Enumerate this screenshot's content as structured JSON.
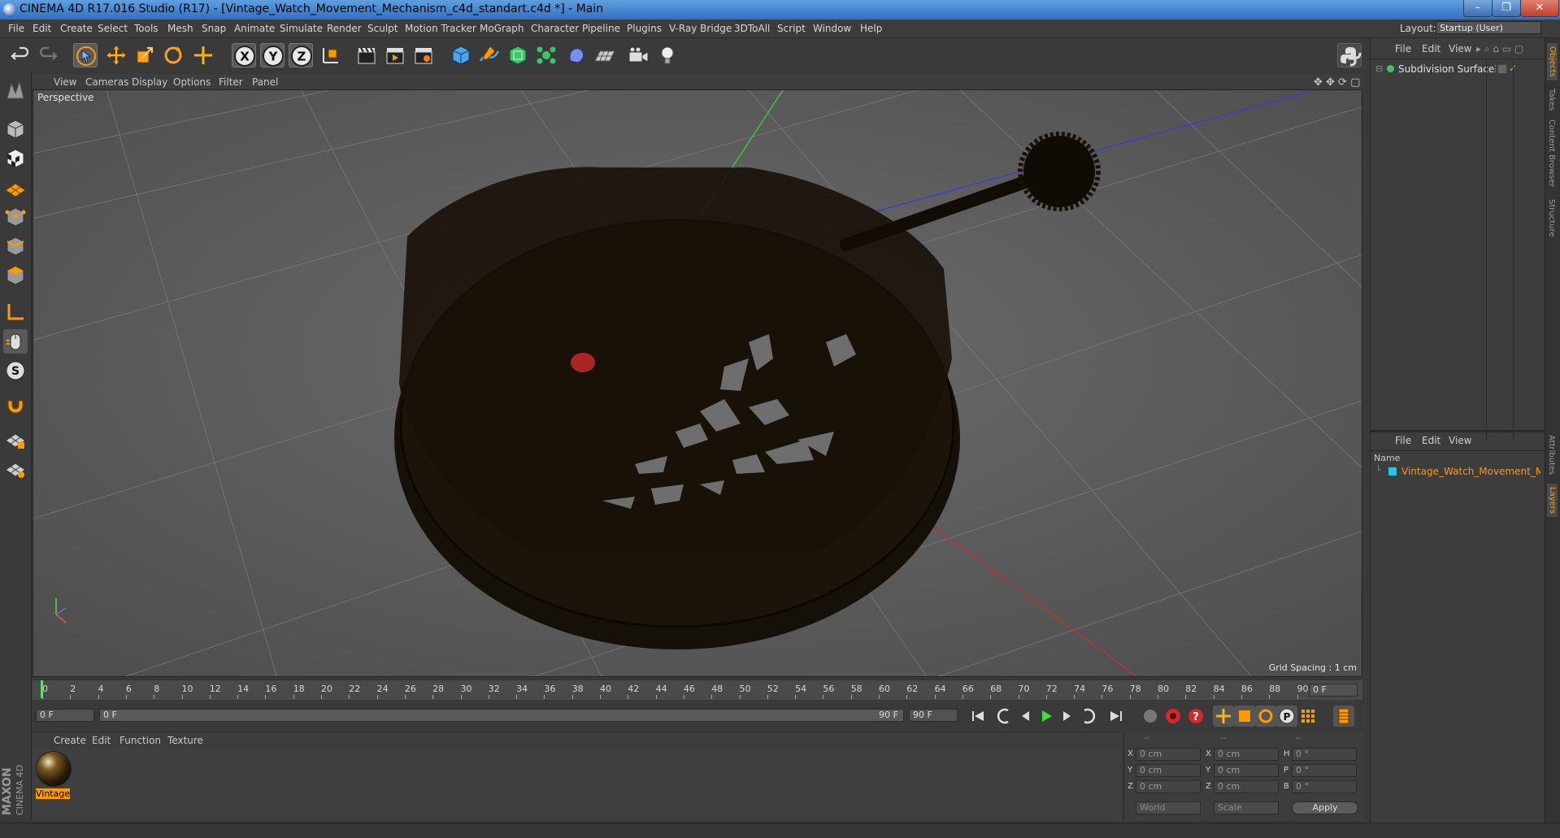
{
  "window": {
    "title": "CINEMA 4D R17.016 Studio (R17) - [Vintage_Watch_Movement_Mechanism_c4d_standart.c4d *] - Main",
    "min": "–",
    "max": "❐",
    "close": "✕"
  },
  "menubar": {
    "items": [
      "File",
      "Edit",
      "Create",
      "Select",
      "Tools",
      "Mesh",
      "Snap",
      "Animate",
      "Simulate",
      "Render",
      "Sculpt",
      "Motion Tracker",
      "MoGraph",
      "Character",
      "Pipeline",
      "Plugins",
      "V-Ray Bridge",
      "3DToAll",
      "Script",
      "Window",
      "Help"
    ],
    "layout_label": "Layout:",
    "layout_value": "Startup (User)"
  },
  "toolbar": {
    "x_label": "X",
    "y_label": "Y",
    "z_label": "Z"
  },
  "viewport": {
    "menu": [
      "View",
      "Cameras",
      "Display",
      "Options",
      "Filter",
      "Panel"
    ],
    "label": "Perspective",
    "grid_spacing": "Grid Spacing : 1 cm"
  },
  "timeline": {
    "ticks": [
      "0",
      "2",
      "4",
      "6",
      "8",
      "10",
      "12",
      "14",
      "16",
      "18",
      "20",
      "22",
      "24",
      "26",
      "28",
      "30",
      "32",
      "34",
      "36",
      "38",
      "40",
      "42",
      "44",
      "46",
      "48",
      "50",
      "52",
      "54",
      "56",
      "58",
      "60",
      "62",
      "64",
      "66",
      "68",
      "70",
      "72",
      "74",
      "76",
      "78",
      "80",
      "82",
      "84",
      "86",
      "88",
      "90"
    ],
    "current_frame": "0 F"
  },
  "playback": {
    "start_field": "0 F",
    "range_start": "0 F",
    "range_end": "90 F",
    "end_field": "90 F"
  },
  "material_manager": {
    "menu": [
      "Create",
      "Edit",
      "Function",
      "Texture"
    ],
    "material_name": "Vintage"
  },
  "coordinates": {
    "header": [
      "--",
      "--",
      "--"
    ],
    "rows": [
      {
        "axis1": "X",
        "val1": "0 cm",
        "axis2": "X",
        "val2": "0 cm",
        "axis3": "H",
        "val3": "0 °"
      },
      {
        "axis1": "Y",
        "val1": "0 cm",
        "axis2": "Y",
        "val2": "0 cm",
        "axis3": "P",
        "val3": "0 °"
      },
      {
        "axis1": "Z",
        "val1": "0 cm",
        "axis2": "Z",
        "val2": "0 cm",
        "axis3": "B",
        "val3": "0 °"
      }
    ],
    "world_select": "World",
    "scale_select": "Scale",
    "apply": "Apply"
  },
  "object_manager": {
    "menu": [
      "File",
      "Edit",
      "View"
    ],
    "objects": [
      "Subdivision Surface"
    ]
  },
  "layer_manager": {
    "menu": [
      "File",
      "Edit",
      "View"
    ],
    "column_name": "Name",
    "items": [
      "Vintage_Watch_Movement_Mecha"
    ]
  },
  "side_tabs": [
    "Objects",
    "Takes",
    "Content Browser",
    "Structure",
    "Attributes",
    "Layers"
  ],
  "logo": {
    "line1": "MAXON",
    "line2": "CINEMA 4D"
  },
  "colors": {
    "accent": "#ff9a00",
    "titlebar": "#3d7bd0",
    "viewport_bg": "#5e5e5e"
  }
}
